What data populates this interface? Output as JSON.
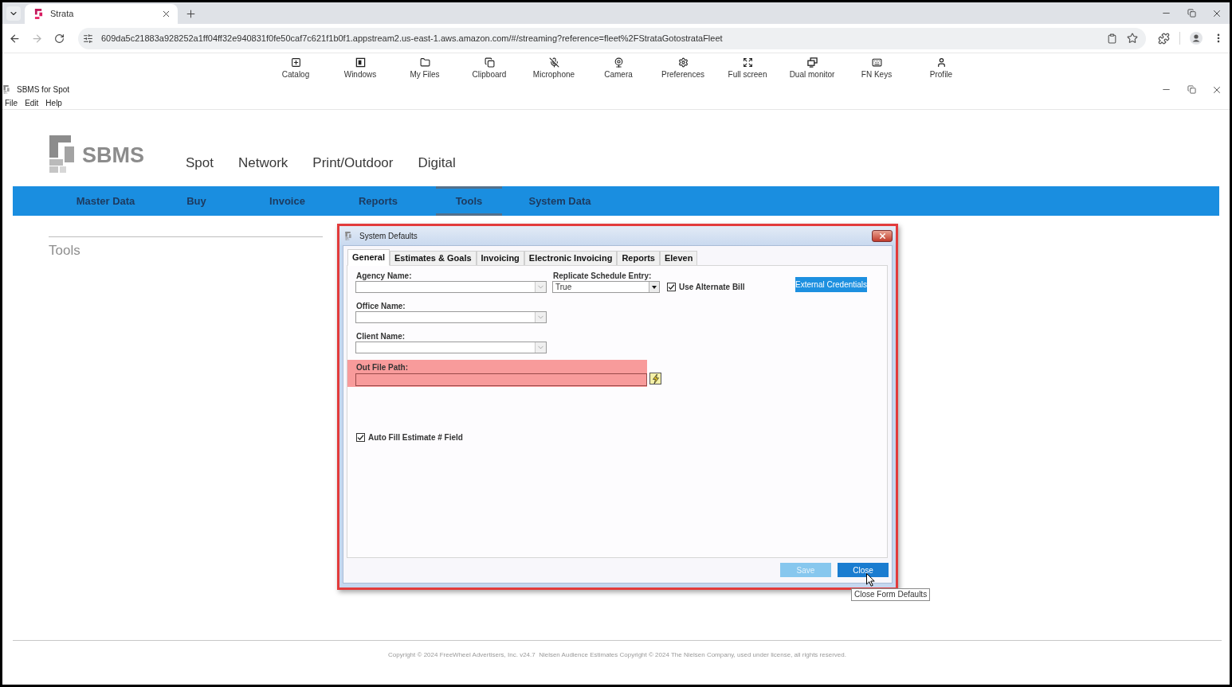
{
  "browser": {
    "tabs": [
      {
        "title": "Strata",
        "selected": true
      }
    ],
    "url": "609da5c21883a928252a1ff04ff32e940831f0fe50caf7c621f1b0f1.appstream2.us-east-1.aws.amazon.com/#/streaming?reference=fleet%2FStrataGotostrataFleet"
  },
  "streaming_toolbar": {
    "items": [
      {
        "label": "Catalog"
      },
      {
        "label": "Windows"
      },
      {
        "label": "My Files"
      },
      {
        "label": "Clipboard"
      },
      {
        "label": "Microphone"
      },
      {
        "label": "Camera"
      },
      {
        "label": "Preferences"
      },
      {
        "label": "Full screen"
      },
      {
        "label": "Dual monitor"
      },
      {
        "label": "FN Keys"
      },
      {
        "label": "Profile"
      }
    ]
  },
  "app_window": {
    "title": "SBMS for Spot",
    "menu": [
      "File",
      "Edit",
      "Help"
    ]
  },
  "header": {
    "logo_text": "SBMS",
    "products": [
      "Spot",
      "Network",
      "Print/Outdoor",
      "Digital"
    ]
  },
  "nav_bar": {
    "items": [
      {
        "label": "Master Data",
        "selected": false
      },
      {
        "label": "Buy",
        "selected": false
      },
      {
        "label": "Invoice",
        "selected": false
      },
      {
        "label": "Reports",
        "selected": false
      },
      {
        "label": "Tools",
        "selected": true
      },
      {
        "label": "System Data",
        "selected": false
      }
    ]
  },
  "sidebar": {
    "title": "Tools"
  },
  "dialog": {
    "title": "System Defaults",
    "tabs": [
      {
        "label": "General",
        "selected": true
      },
      {
        "label": "Estimates & Goals",
        "selected": false
      },
      {
        "label": "Invoicing",
        "selected": false
      },
      {
        "label": "Electronic Invoicing",
        "selected": false
      },
      {
        "label": "Reports",
        "selected": false
      },
      {
        "label": "Eleven",
        "selected": false
      }
    ],
    "general": {
      "agency_name": {
        "label": "Agency Name:"
      },
      "replicate_schedule_entry": {
        "label": "Replicate Schedule Entry:",
        "value": "True"
      },
      "use_alternate_bill": {
        "label": "Use Alternate Bill",
        "checked": true
      },
      "external_credentials": {
        "label": "External Credentials"
      },
      "office_name": {
        "label": "Office Name:"
      },
      "client_name": {
        "label": "Client Name:"
      },
      "out_file_path": {
        "label": "Out File Path:",
        "highlighted": true
      },
      "auto_fill_estimate": {
        "label": "Auto Fill Estimate # Field",
        "checked": true
      }
    },
    "buttons": [
      {
        "label": "Save",
        "disabled": true
      },
      {
        "label": "Close",
        "disabled": false
      }
    ],
    "tooltip": "Close Form Defaults"
  },
  "footer": {
    "copyright": "Copyright © 2024 FreeWheel Advertisers, Inc. v24.7  Nielsen Audience Estimates Copyright © 2024 The Nielsen Company, used under license, all rights reserved."
  }
}
